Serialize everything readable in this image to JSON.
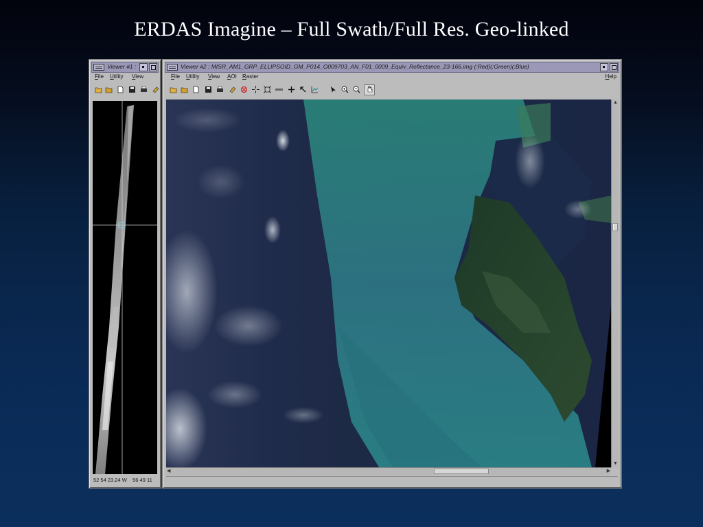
{
  "slide": {
    "title": "ERDAS Imagine – Full Swath/Full Res. Geo-linked"
  },
  "viewer1": {
    "title": "Viewer #1 :",
    "menu": [
      "File",
      "Utility",
      "View"
    ],
    "status_text": "52 54 23.24 W    56 49 11"
  },
  "viewer2": {
    "title": "Viewer #2 : MISR_AM1_GRP_ELLIPSOID_GM_P014_O009703_AN_F01_0009_Equiv_Reflectance_23-166.img (:Red)(:Green)(:Blue)",
    "menu": [
      "File",
      "Utility",
      "View",
      "AOI",
      "Raster"
    ],
    "help_label": "Help"
  },
  "icons": {
    "viewer1_toolbar": [
      "open-folder-icon",
      "folder-icon",
      "document-icon",
      "save-icon",
      "print-icon"
    ],
    "viewer2_toolbar": [
      "open-folder-icon",
      "folder-icon",
      "document-icon",
      "save-icon",
      "print-icon",
      "eraser-icon",
      "clear-icon",
      "crosshair-icon",
      "fit-icon",
      "measure-icon",
      "plus-icon",
      "inquire-icon",
      "profile-icon",
      "pointer-icon",
      "zoom-in-icon",
      "zoom-out-icon",
      "pan-hand-icon"
    ]
  },
  "colors": {
    "window_bg": "#bcbcbc",
    "titlebar": "#9a98b6",
    "ocean_deep": "#1a2440",
    "shallow_water": "#2a8a80"
  }
}
